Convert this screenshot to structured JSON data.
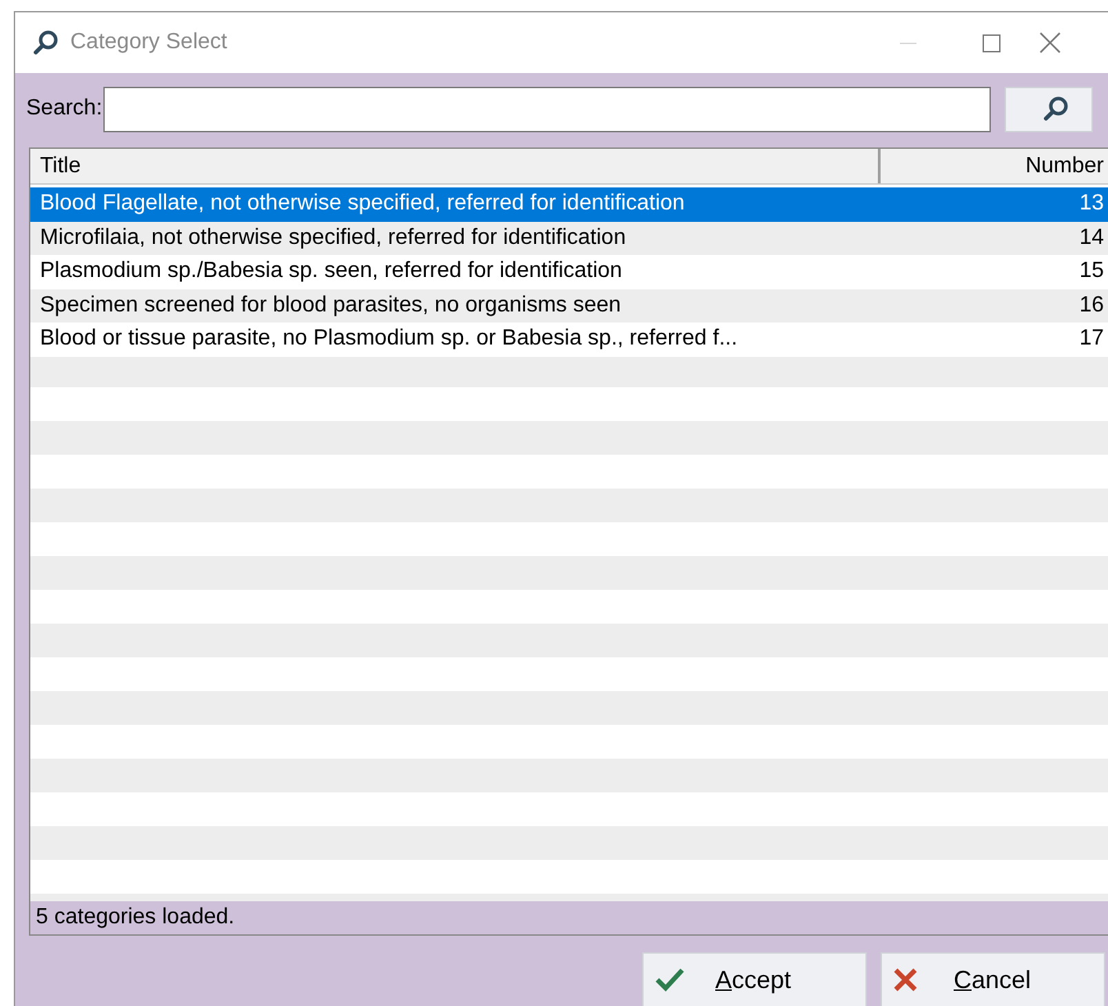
{
  "window": {
    "title": "Category Select"
  },
  "search": {
    "label": "Search:"
  },
  "table": {
    "columns": [
      "Title",
      "Number"
    ],
    "rows": [
      {
        "title": "Blood Flagellate, not otherwise specified, referred for identification",
        "number": "13",
        "selected": true
      },
      {
        "title": "Microfilaia, not otherwise specified, referred for identification",
        "number": "14",
        "selected": false
      },
      {
        "title": "Plasmodium sp./Babesia sp. seen, referred for identification",
        "number": "15",
        "selected": false
      },
      {
        "title": "Specimen screened for blood parasites, no organisms seen",
        "number": "16",
        "selected": false
      },
      {
        "title": "Blood or tissue parasite, no Plasmodium sp. or Babesia sp., referred f...",
        "number": "17",
        "selected": false
      }
    ]
  },
  "status_bar": "5 categories loaded.",
  "buttons": [
    {
      "kind": "accept",
      "label": "Accept"
    },
    {
      "kind": "cancel",
      "label": "Cancel"
    }
  ]
}
